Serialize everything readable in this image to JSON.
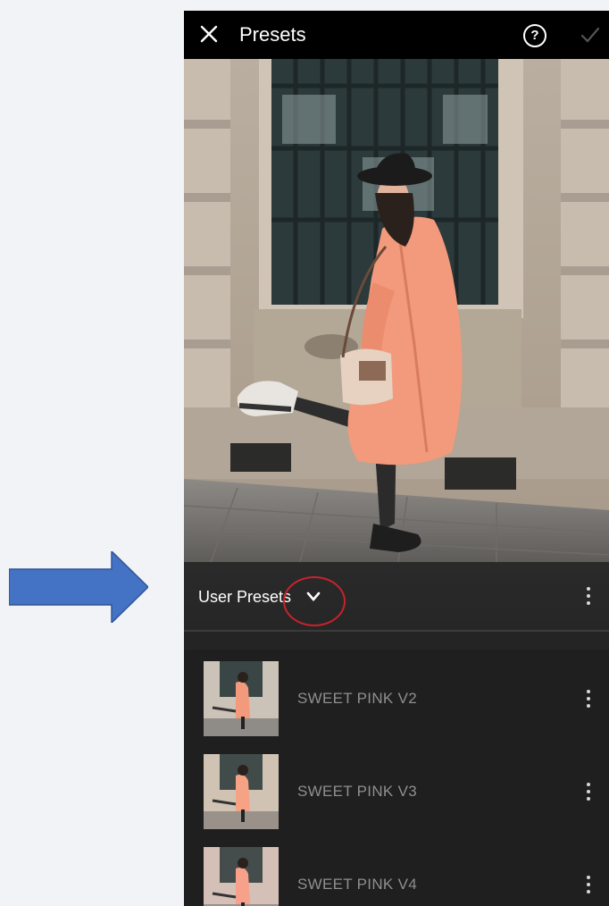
{
  "header": {
    "close_icon": "close-icon",
    "title": "Presets",
    "help_icon": "help-circle-icon",
    "help_glyph": "?",
    "confirm_icon": "checkmark-icon"
  },
  "preset_group": {
    "label": "User Presets",
    "dropdown_icon": "chevron-down-icon",
    "more_icon": "more-vertical-icon"
  },
  "presets": [
    {
      "name": "SWEET PINK V2"
    },
    {
      "name": "SWEET PINK V3"
    },
    {
      "name": "SWEET PINK V4"
    }
  ],
  "colors": {
    "annotation_arrow": "#4472c4",
    "annotation_circle": "#c8232c",
    "coat": "#f39a7c",
    "panel_bg": "#1f1f1f"
  }
}
